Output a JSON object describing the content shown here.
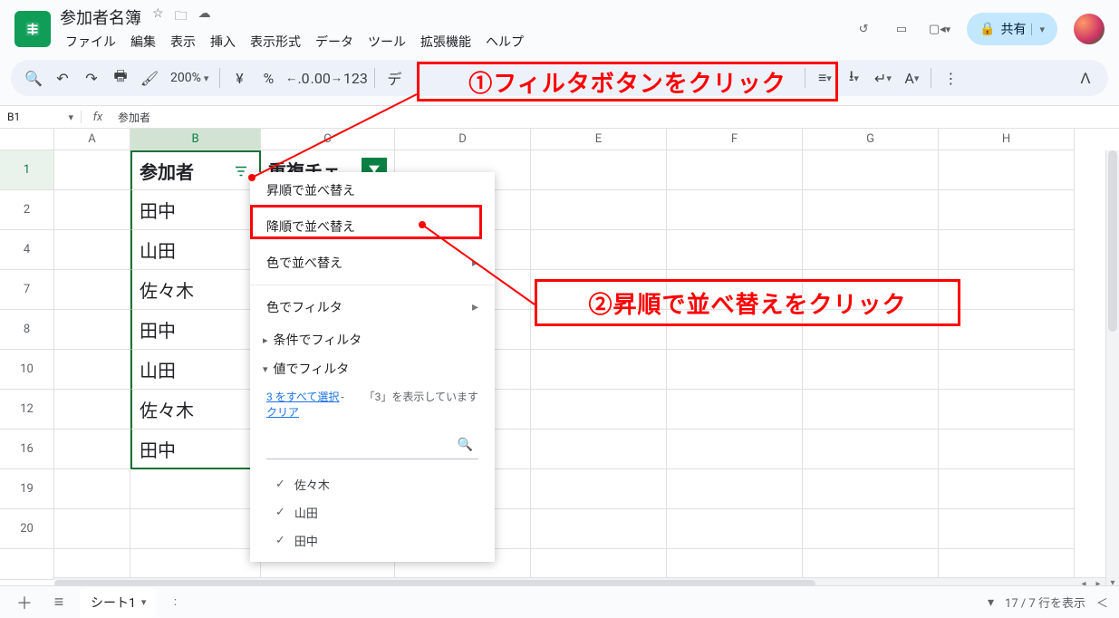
{
  "doc_title": "参加者名簿",
  "menu": {
    "file": "ファイル",
    "edit": "編集",
    "view": "表示",
    "insert": "挿入",
    "format": "表示形式",
    "data": "データ",
    "tools": "ツール",
    "extensions": "拡張機能",
    "help": "ヘルプ"
  },
  "share_label": "共有",
  "toolbar": {
    "zoom": "200%",
    "currency": "¥",
    "percent": "%",
    "dec_dec": ".0",
    "inc_dec": ".00",
    "num": "123",
    "more": "⋮"
  },
  "name_box": "B1",
  "formula": "参加者",
  "columns": {
    "A": "A",
    "B": "B",
    "C": "C",
    "D": "D",
    "E": "E",
    "F": "F",
    "G": "G",
    "H": "H"
  },
  "row_nums": [
    "1",
    "2",
    "4",
    "7",
    "8",
    "10",
    "12",
    "16",
    "19",
    "20"
  ],
  "B_header": "参加者",
  "C_header": "重複チェ",
  "B_values": [
    "田中",
    "山田",
    "佐々木",
    "田中",
    "山田",
    "佐々木",
    "田中"
  ],
  "filter_popup": {
    "sort_asc": "昇順で並べ替え",
    "sort_desc": "降順で並べ替え",
    "sort_color": "色で並べ替え",
    "filter_color": "色でフィルタ",
    "filter_cond": "条件でフィルタ",
    "filter_value": "値でフィルタ",
    "select_all": "3 をすべて選択",
    "clear": "クリア",
    "showing": "「3」を表示しています",
    "values": [
      "佐々木",
      "山田",
      "田中"
    ]
  },
  "annot1": "①フィルタボタンをクリック",
  "annot2": "②昇順で並べ替えをクリック",
  "sheet_tab": "シート1",
  "status_rows": "17 / 7 行を表示"
}
